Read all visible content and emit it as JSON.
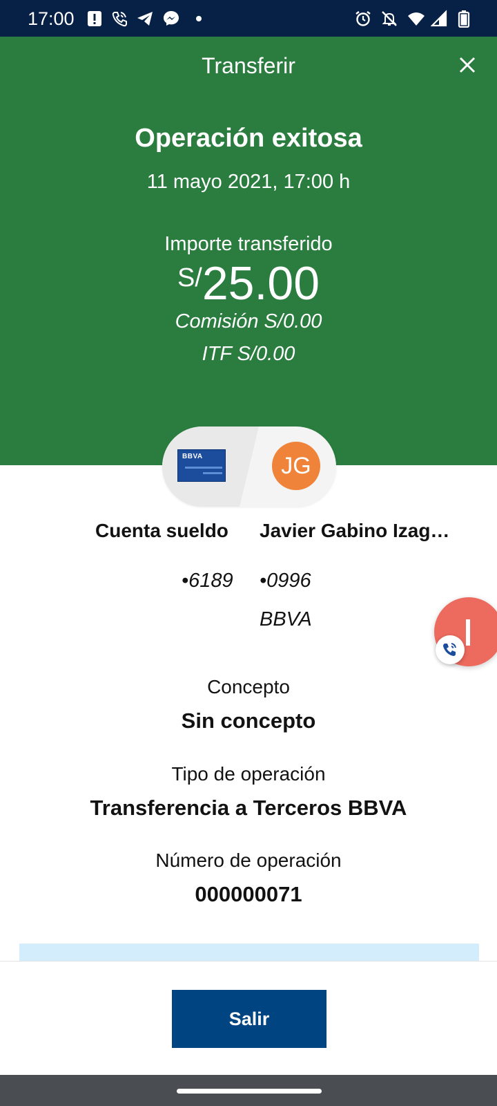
{
  "status_bar": {
    "time": "17:00",
    "icons": [
      "alert-icon",
      "wifi-call-icon",
      "telegram-icon",
      "messenger-icon",
      "dot-icon",
      "alarm-icon",
      "notifications-off-icon",
      "wifi-icon",
      "signal-icon",
      "battery-icon"
    ]
  },
  "header": {
    "title": "Transferir",
    "close_icon": "close-icon",
    "status": "Operación exitosa",
    "datetime": "11 mayo 2021, 17:00 h",
    "amount_label": "Importe transferido",
    "currency": "S/",
    "amount": "25.00",
    "commission": "Comisión  S/0.00",
    "itf": "ITF  S/0.00",
    "background_color": "#2a7c3f"
  },
  "origin": {
    "name": "Cuenta sueldo",
    "number": "•6189",
    "card_brand": "BBVA"
  },
  "destination": {
    "name": "Javier Gabino Izag…",
    "initials": "JG",
    "number": "•0996",
    "bank": "BBVA",
    "avatar_color": "#f0833a"
  },
  "details": {
    "concept_label": "Concepto",
    "concept_value": "Sin concepto",
    "type_label": "Tipo de operación",
    "type_value": "Transferencia a Terceros BBVA",
    "number_label": "Número de operación",
    "number_value": "000000071"
  },
  "actions": {
    "exit_label": "Salir",
    "exit_color": "#004481"
  },
  "floating_bubble": {
    "color": "#ec6a5e",
    "icon": "phone-call-icon"
  }
}
